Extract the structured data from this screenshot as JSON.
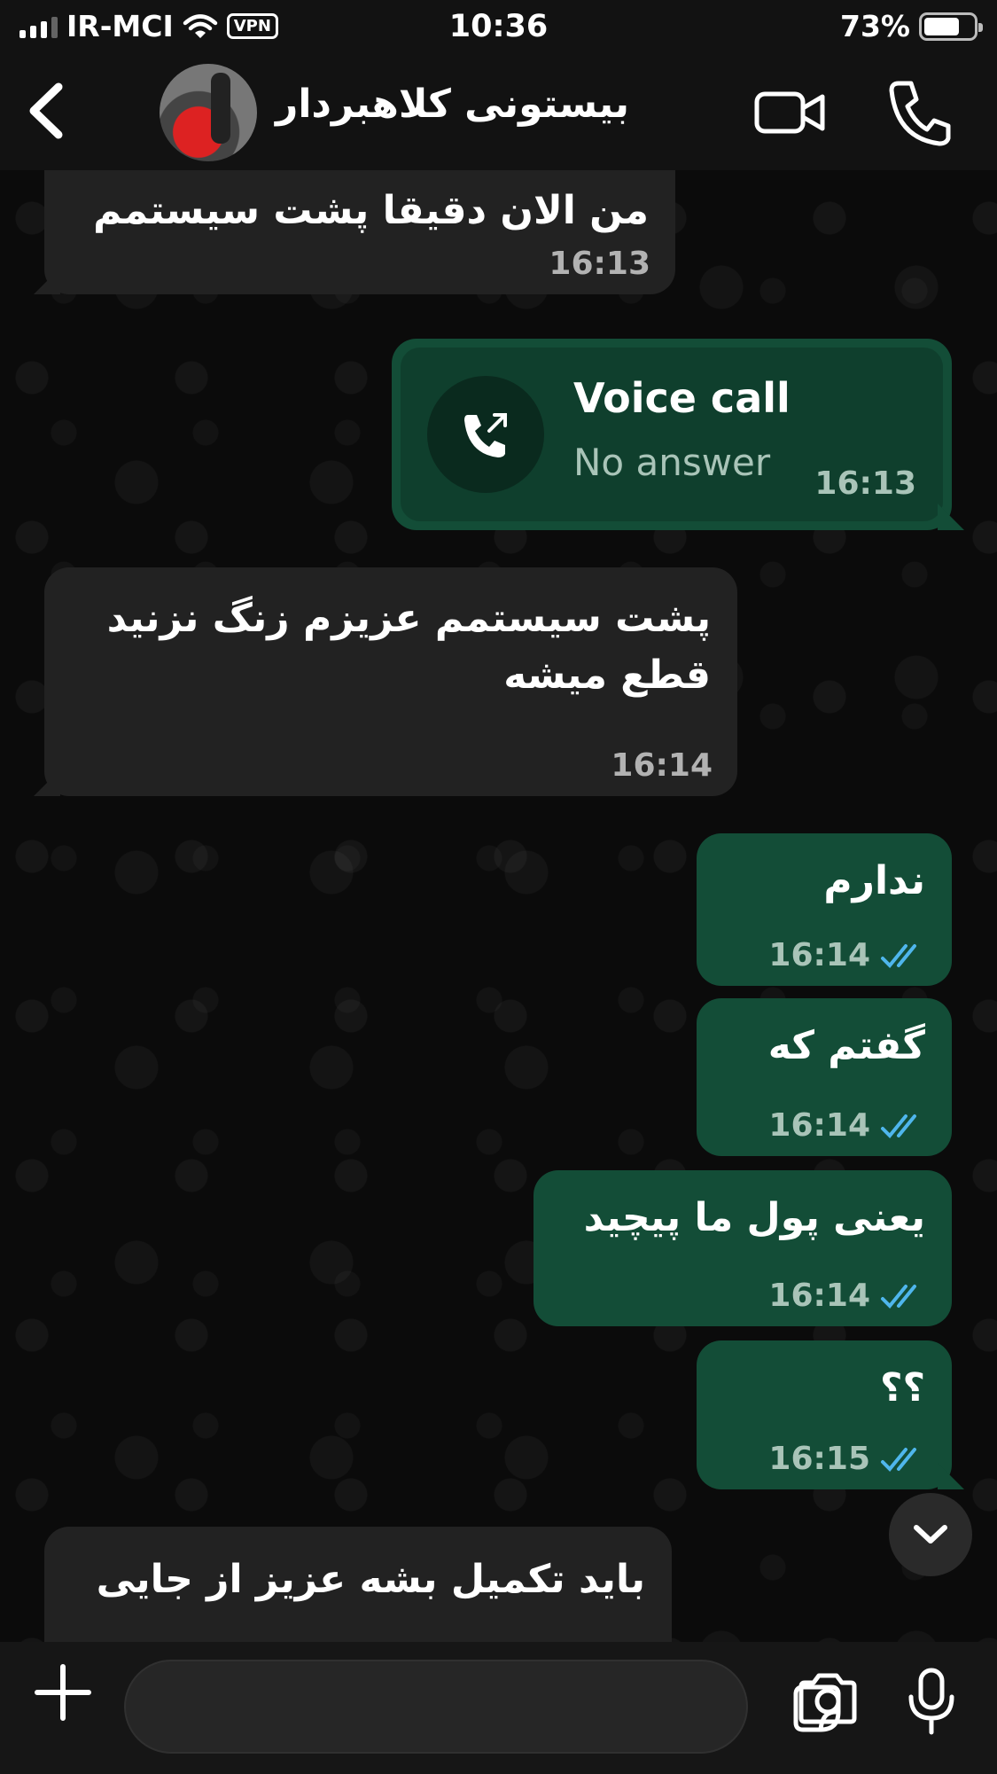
{
  "status_bar": {
    "carrier": "IR-MCI",
    "vpn": "VPN",
    "time": "10:36",
    "battery": "73%",
    "battery_level": 0.73
  },
  "header": {
    "contact_name": "بیستونی کلاهبردار"
  },
  "messages": [
    {
      "dir": "in",
      "text": "من الان دقیقا پشت سیستمم",
      "time": "16:13"
    },
    {
      "dir": "out",
      "type": "call",
      "title": "Voice call",
      "subtitle": "No answer",
      "time": "16:13"
    },
    {
      "dir": "in",
      "text": "پشت سیستمم عزیزم زنگ نزنید\nقطع میشه",
      "time": "16:14"
    },
    {
      "dir": "out",
      "text": "ندارم",
      "time": "16:14"
    },
    {
      "dir": "out",
      "text": "گفتم که",
      "time": "16:14"
    },
    {
      "dir": "out",
      "text": "یعنی پول ما پیچید",
      "time": "16:14"
    },
    {
      "dir": "out",
      "text": "؟؟",
      "time": "16:15"
    },
    {
      "dir": "in",
      "text": "باید تکمیل بشه عزیز از جایی"
    }
  ],
  "colors": {
    "incoming_bubble": "#222222",
    "outgoing_bubble": "#134d37",
    "read_ticks": "#4fb6ec"
  },
  "composer": {
    "placeholder": ""
  }
}
